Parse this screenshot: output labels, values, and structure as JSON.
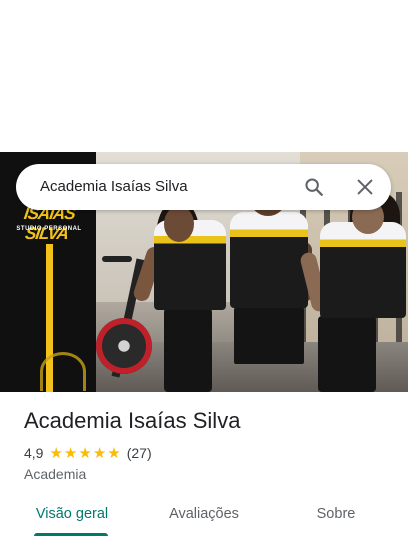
{
  "search": {
    "query": "Academia Isaías Silva",
    "search_icon": "search-icon",
    "clear_icon": "close-icon"
  },
  "hero": {
    "banner_title": "ISAÍAS SILVA",
    "banner_subtitle": "STUDIO PERSONAL"
  },
  "place": {
    "name": "Academia Isaías Silva",
    "rating": "4,9",
    "stars": 5,
    "review_count": "(27)",
    "category": "Academia"
  },
  "tabs": [
    {
      "label": "Visão geral",
      "active": true
    },
    {
      "label": "Avaliações",
      "active": false
    },
    {
      "label": "Sobre",
      "active": false
    }
  ],
  "colors": {
    "accent": "#00796b",
    "star": "#fbbc04",
    "banner_yellow": "#f2c21b"
  }
}
